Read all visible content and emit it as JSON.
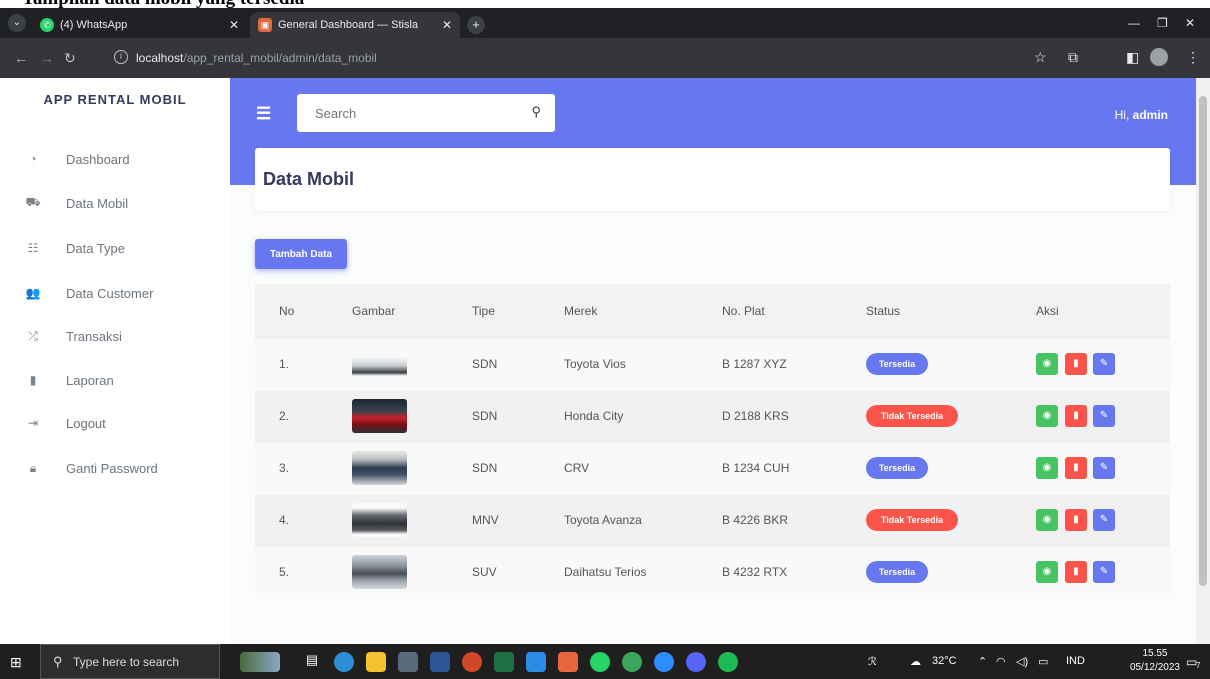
{
  "doc_heading": "Tampilan data mobil yang tersedia",
  "browser": {
    "tabs": [
      {
        "label": "(4) WhatsApp",
        "active": false
      },
      {
        "label": "General Dashboard — Stisla",
        "active": true
      }
    ],
    "url_host": "localhost",
    "url_path": "/app_rental_mobil/admin/data_mobil"
  },
  "sidebar": {
    "brand": "APP RENTAL MOBIL",
    "items": [
      {
        "label": "Dashboard",
        "icon": "dashboard-icon"
      },
      {
        "label": "Data Mobil",
        "icon": "car-icon"
      },
      {
        "label": "Data Type",
        "icon": "list-icon"
      },
      {
        "label": "Data Customer",
        "icon": "users-icon"
      },
      {
        "label": "Transaksi",
        "icon": "random-icon"
      },
      {
        "label": "Laporan",
        "icon": "clipboard-icon"
      },
      {
        "label": "Logout",
        "icon": "logout-icon"
      },
      {
        "label": "Ganti Password",
        "icon": "lock-icon"
      }
    ]
  },
  "navbar": {
    "search_placeholder": "Search",
    "greeting": "Hi,",
    "user": "admin"
  },
  "main": {
    "title": "Data Mobil",
    "add_button": "Tambah Data",
    "columns": [
      "No",
      "Gambar",
      "Tipe",
      "Merek",
      "No. Plat",
      "Status",
      "Aksi"
    ],
    "rows": [
      {
        "no": "1.",
        "tipe": "SDN",
        "merek": "Toyota Vios",
        "plat": "B 1287 XYZ",
        "status": "Tersedia"
      },
      {
        "no": "2.",
        "tipe": "SDN",
        "merek": "Honda City",
        "plat": "D 2188 KRS",
        "status": "Tidak Tersedia"
      },
      {
        "no": "3.",
        "tipe": "SDN",
        "merek": "CRV",
        "plat": "B 1234 CUH",
        "status": "Tersedia"
      },
      {
        "no": "4.",
        "tipe": "MNV",
        "merek": "Toyota Avanza",
        "plat": "B 4226 BKR",
        "status": "Tidak Tersedia"
      },
      {
        "no": "5.",
        "tipe": "SUV",
        "merek": "Daihatsu Terios",
        "plat": "B 4232 RTX",
        "status": "Tersedia"
      }
    ]
  },
  "colors": {
    "primary": "#6777ef",
    "success": "#47c363",
    "danger": "#fc544b",
    "status_available": "#6777ef",
    "status_unavailable": "#fc544b"
  },
  "taskbar": {
    "search_placeholder": "Type here to search",
    "weather": "32°C",
    "lang": "IND",
    "time": "15.55",
    "date": "05/12/2023",
    "notifications": "7"
  }
}
